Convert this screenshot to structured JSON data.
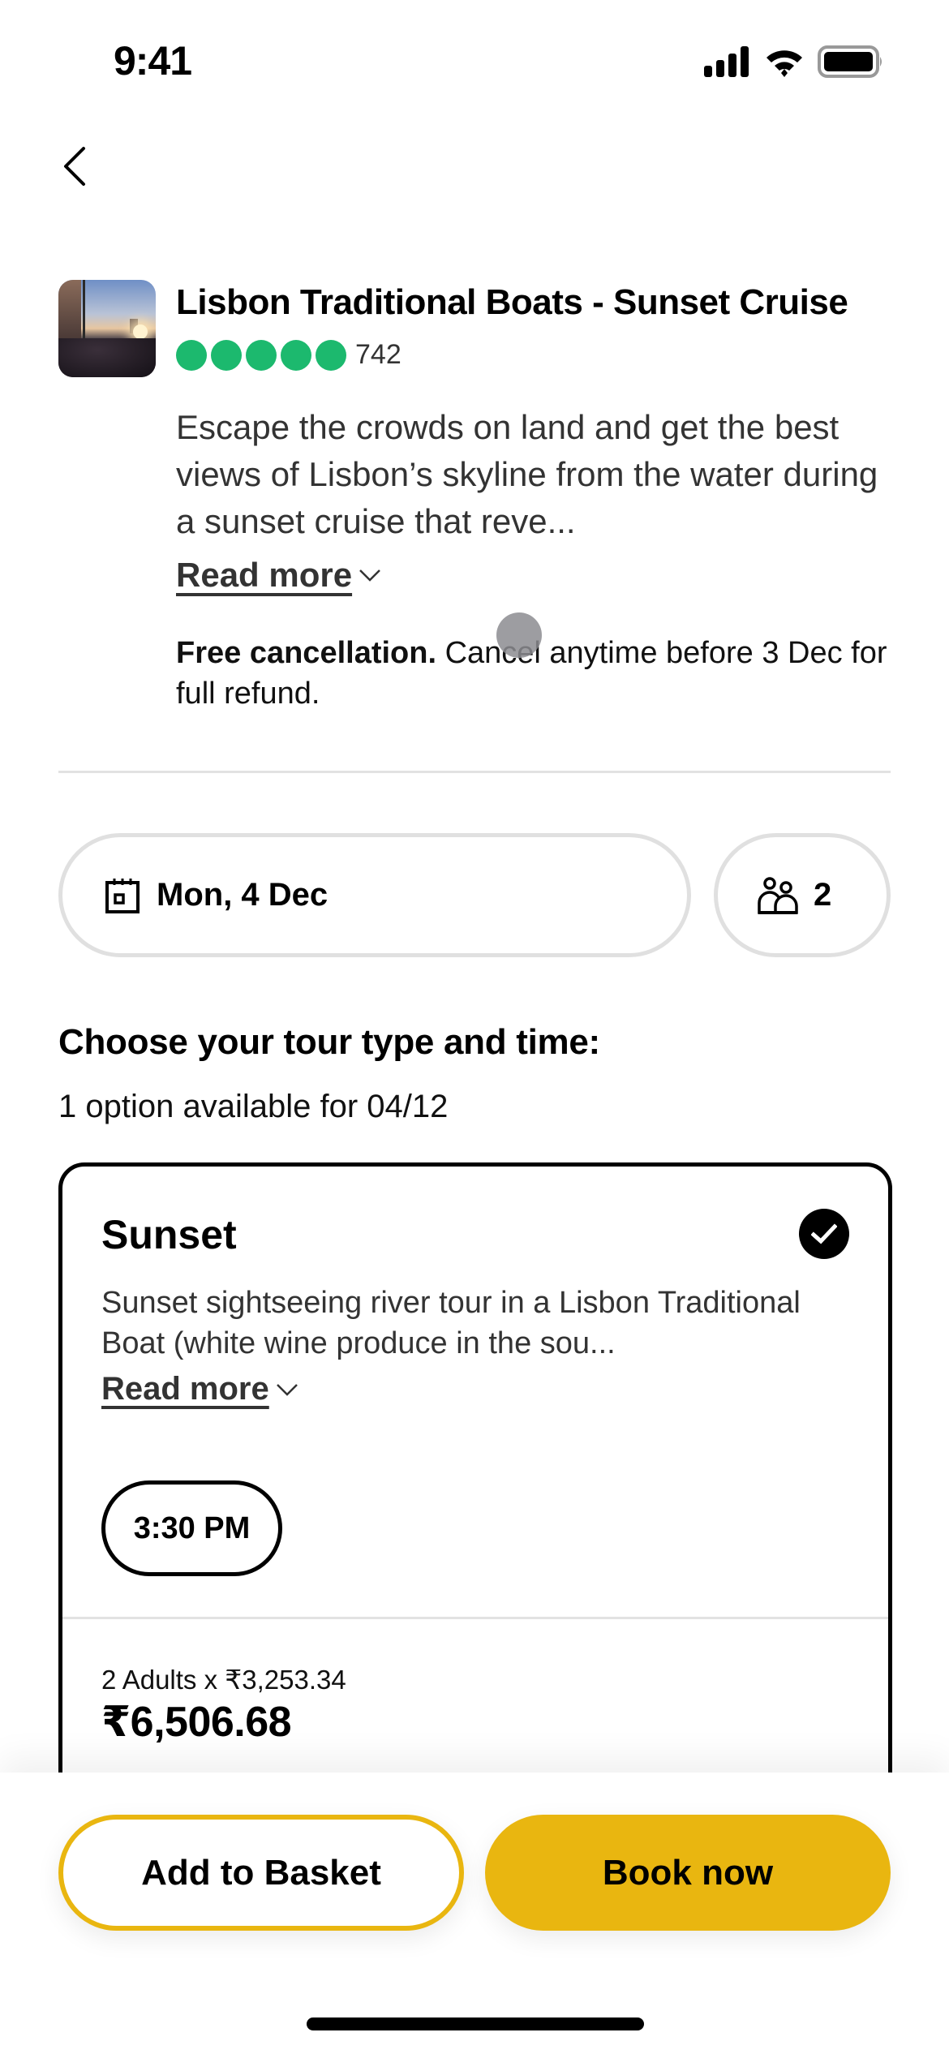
{
  "status_bar": {
    "time": "9:41",
    "icons": [
      "cellular-signal-icon",
      "wifi-icon",
      "battery-icon"
    ]
  },
  "nav": {
    "back_icon": "chevron-left-icon"
  },
  "product": {
    "thumbnail_alt": "Sunset sailboat on the river",
    "title": "Lisbon Traditional Boats - Sunset Cruise",
    "rating": {
      "bubbles_filled": 5,
      "bubbles_total": 5,
      "review_count": "742",
      "color": "#1cb96e"
    },
    "description": "Escape the crowds on land and get the best views of Lisbon’s skyline from the water during a sunset cruise that reve...",
    "read_more_label": "Read more",
    "cancellation": {
      "bold": "Free cancellation.",
      "text": " Cancel anytime before 3 Dec for full refund."
    }
  },
  "selectors": {
    "date": {
      "icon": "calendar-icon",
      "value": "Mon, 4 Dec"
    },
    "travellers": {
      "icon": "people-icon",
      "value": "2"
    }
  },
  "options_section": {
    "title": "Choose your tour type and time:",
    "subtitle": "1 option available for 04/12"
  },
  "option_card": {
    "title": "Sunset",
    "selected": true,
    "description": "Sunset sightseeing river tour in a Lisbon Traditional Boat (white wine produce in the sou...",
    "read_more_label": "Read more",
    "time_slots": [
      "3:30 PM"
    ],
    "price_breakdown": "2 Adults x ₹3,253.34",
    "price_total": "₹6,506.68"
  },
  "actions": {
    "add_to_basket": "Add to Basket",
    "book_now": "Book now",
    "accent_color": "#e9b610"
  }
}
